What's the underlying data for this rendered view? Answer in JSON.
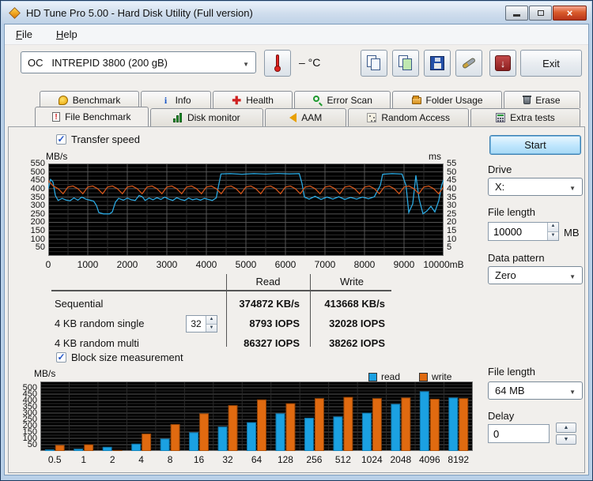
{
  "window": {
    "title": "HD Tune Pro 5.00 - Hard Disk Utility (Full version)",
    "buttons": {
      "minimize": "minimize",
      "maximize": "maximize",
      "close": "×"
    }
  },
  "menu": {
    "file": "File",
    "help": "Help"
  },
  "toolbar": {
    "drive_select_value": "OC   INTREPID 3800 (200 gB)",
    "temperature": "– °C",
    "exit_label": "Exit",
    "download_glyph": "↓",
    "icons": [
      "thermometer-icon",
      "copy-text-icon",
      "copy-screenshot-icon",
      "save-icon",
      "options-icon",
      "download-icon"
    ]
  },
  "tabs_row1": [
    {
      "label": "Benchmark"
    },
    {
      "label": "Info"
    },
    {
      "label": "Health"
    },
    {
      "label": "Error Scan"
    },
    {
      "label": "Folder Usage"
    },
    {
      "label": "Erase"
    }
  ],
  "tabs_row2": [
    {
      "label": "File Benchmark",
      "active": true,
      "page_icon_glyph": "!"
    },
    {
      "label": "Disk monitor",
      "active": false
    },
    {
      "label": "AAM",
      "active": false
    },
    {
      "label": "Random Access",
      "active": false
    },
    {
      "label": "Extra tests",
      "active": false
    }
  ],
  "panel": {
    "checkmark": "✓",
    "transfer_speed_label": "Transfer speed",
    "transfer_speed_checked": true,
    "block_size_label": "Block size measurement",
    "block_size_checked": true,
    "start_label": "Start",
    "drive_label": "Drive",
    "drive_value": "X:",
    "file_length_label": "File length",
    "file_length_value": "10000",
    "file_length_unit": "MB",
    "data_pattern_label": "Data pattern",
    "data_pattern_value": "Zero",
    "file_length2_label": "File length",
    "file_length2_value": "64 MB",
    "delay_label": "Delay",
    "delay_value": "0"
  },
  "table": {
    "col_read": "Read",
    "col_write": "Write",
    "queue_depth": "32",
    "rows": [
      {
        "label": "Sequential",
        "read": "374872 KB/s",
        "write": "413668 KB/s"
      },
      {
        "label": "4 KB random single",
        "read": "8793 IOPS",
        "write": "32028 IOPS"
      },
      {
        "label": "4 KB random multi",
        "read": "86327 IOPS",
        "write": "38262 IOPS"
      }
    ]
  },
  "colors": {
    "read": "#1ba1e2",
    "read_dark": "#0f6e9e",
    "write": "#e06a10",
    "write_dark": "#8e4208",
    "grid_major": "#555555",
    "grid_minor": "#2b2b2b",
    "plot_bg": "#000000"
  },
  "chart_data": [
    {
      "type": "line",
      "title": "Transfer speed",
      "ylabel": "MB/s",
      "ylabel_right": "ms",
      "xlabel": "mB",
      "ylim": [
        0,
        550
      ],
      "xlim": [
        0,
        10000
      ],
      "yticks_left": [
        550,
        500,
        450,
        400,
        350,
        300,
        250,
        200,
        150,
        100,
        50
      ],
      "yticks_right": [
        55,
        50,
        45,
        40,
        35,
        30,
        25,
        20,
        15,
        10,
        5
      ],
      "xtick_values": [
        0,
        1000,
        2000,
        3000,
        4000,
        5000,
        6000,
        7000,
        8000,
        9000,
        10000
      ],
      "xtick_labels": [
        "0",
        "1000",
        "2000",
        "3000",
        "4000",
        "5000",
        "6000",
        "7000",
        "8000",
        "9000",
        "10000mB"
      ],
      "grid": true,
      "series": [
        {
          "name": "read",
          "color": "#2ba8e0",
          "points": [
            [
              0,
              400
            ],
            [
              60,
              455
            ],
            [
              120,
              440
            ],
            [
              180,
              360
            ],
            [
              250,
              330
            ],
            [
              350,
              342
            ],
            [
              450,
              333
            ],
            [
              550,
              328
            ],
            [
              650,
              345
            ],
            [
              750,
              332
            ],
            [
              850,
              350
            ],
            [
              950,
              338
            ],
            [
              1050,
              332
            ],
            [
              1150,
              326
            ],
            [
              1220,
              300
            ],
            [
              1280,
              258
            ],
            [
              1400,
              250
            ],
            [
              1550,
              250
            ],
            [
              1620,
              262
            ],
            [
              1700,
              320
            ],
            [
              1780,
              342
            ],
            [
              1900,
              332
            ],
            [
              2000,
              344
            ],
            [
              2100,
              334
            ],
            [
              2200,
              330
            ],
            [
              2300,
              360
            ],
            [
              2380,
              352
            ],
            [
              2450,
              330
            ],
            [
              2550,
              344
            ],
            [
              2650,
              334
            ],
            [
              2750,
              346
            ],
            [
              2850,
              336
            ],
            [
              2950,
              350
            ],
            [
              3050,
              338
            ],
            [
              3150,
              330
            ],
            [
              3250,
              346
            ],
            [
              3350,
              336
            ],
            [
              3450,
              330
            ],
            [
              3550,
              344
            ],
            [
              3650,
              334
            ],
            [
              3750,
              340
            ],
            [
              3850,
              332
            ],
            [
              3950,
              342
            ],
            [
              4050,
              336
            ],
            [
              4150,
              330
            ],
            [
              4250,
              345
            ],
            [
              4310,
              420
            ],
            [
              4370,
              488
            ],
            [
              4600,
              490
            ],
            [
              4900,
              486
            ],
            [
              5200,
              490
            ],
            [
              5500,
              487
            ],
            [
              5800,
              491
            ],
            [
              6100,
              488
            ],
            [
              6350,
              490
            ],
            [
              6420,
              430
            ],
            [
              6480,
              350
            ],
            [
              6600,
              338
            ],
            [
              6750,
              355
            ],
            [
              6900,
              336
            ],
            [
              7050,
              350
            ],
            [
              7200,
              338
            ],
            [
              7350,
              352
            ],
            [
              7500,
              336
            ],
            [
              7650,
              348
            ],
            [
              7800,
              338
            ],
            [
              7950,
              350
            ],
            [
              8100,
              340
            ],
            [
              8250,
              352
            ],
            [
              8400,
              420
            ],
            [
              8460,
              486
            ],
            [
              8700,
              490
            ],
            [
              8950,
              487
            ],
            [
              9050,
              420
            ],
            [
              9120,
              258
            ],
            [
              9220,
              310
            ],
            [
              9300,
              480
            ],
            [
              9380,
              340
            ],
            [
              9480,
              250
            ],
            [
              9580,
              268
            ],
            [
              9680,
              295
            ],
            [
              9780,
              262
            ],
            [
              9880,
              330
            ],
            [
              9950,
              420
            ],
            [
              10000,
              452
            ]
          ]
        },
        {
          "name": "write",
          "color": "#d4571c",
          "x_start": 0,
          "x_step": 125,
          "values": [
            448,
            416,
            400,
            370,
            410,
            416,
            400,
            370,
            410,
            416,
            400,
            370,
            410,
            416,
            400,
            370,
            410,
            416,
            400,
            370,
            410,
            416,
            400,
            370,
            410,
            416,
            400,
            370,
            410,
            416,
            400,
            370,
            410,
            416,
            400,
            370,
            410,
            416,
            400,
            370,
            410,
            416,
            400,
            370,
            410,
            416,
            400,
            370,
            410,
            416,
            400,
            370,
            410,
            416,
            400,
            370,
            410,
            416,
            400,
            370,
            410,
            416,
            400,
            370,
            410,
            416,
            400,
            370,
            410,
            416,
            400,
            370,
            410,
            416,
            400,
            370,
            410,
            416,
            400,
            370,
            410
          ]
        }
      ]
    },
    {
      "type": "bar",
      "title": "Block size measurement",
      "ylabel": "MB/s",
      "ylim": [
        0,
        550
      ],
      "yticks": [
        500,
        450,
        400,
        350,
        300,
        250,
        200,
        150,
        100,
        50
      ],
      "categories": [
        "0.5",
        "1",
        "2",
        "4",
        "8",
        "16",
        "32",
        "64",
        "128",
        "256",
        "512",
        "1024",
        "2048",
        "4096",
        "8192"
      ],
      "grid": true,
      "legend_position": "top-right",
      "legend": [
        {
          "name": "read",
          "color": "#1ba1e2"
        },
        {
          "name": "write",
          "color": "#e06a10"
        }
      ],
      "series": [
        {
          "name": "read",
          "values": [
            10,
            15,
            30,
            55,
            95,
            145,
            190,
            225,
            295,
            260,
            270,
            300,
            370,
            470,
            420
          ]
        },
        {
          "name": "write",
          "values": [
            45,
            50,
            5,
            135,
            210,
            295,
            360,
            405,
            375,
            415,
            425,
            415,
            420,
            410,
            415
          ]
        }
      ]
    }
  ]
}
